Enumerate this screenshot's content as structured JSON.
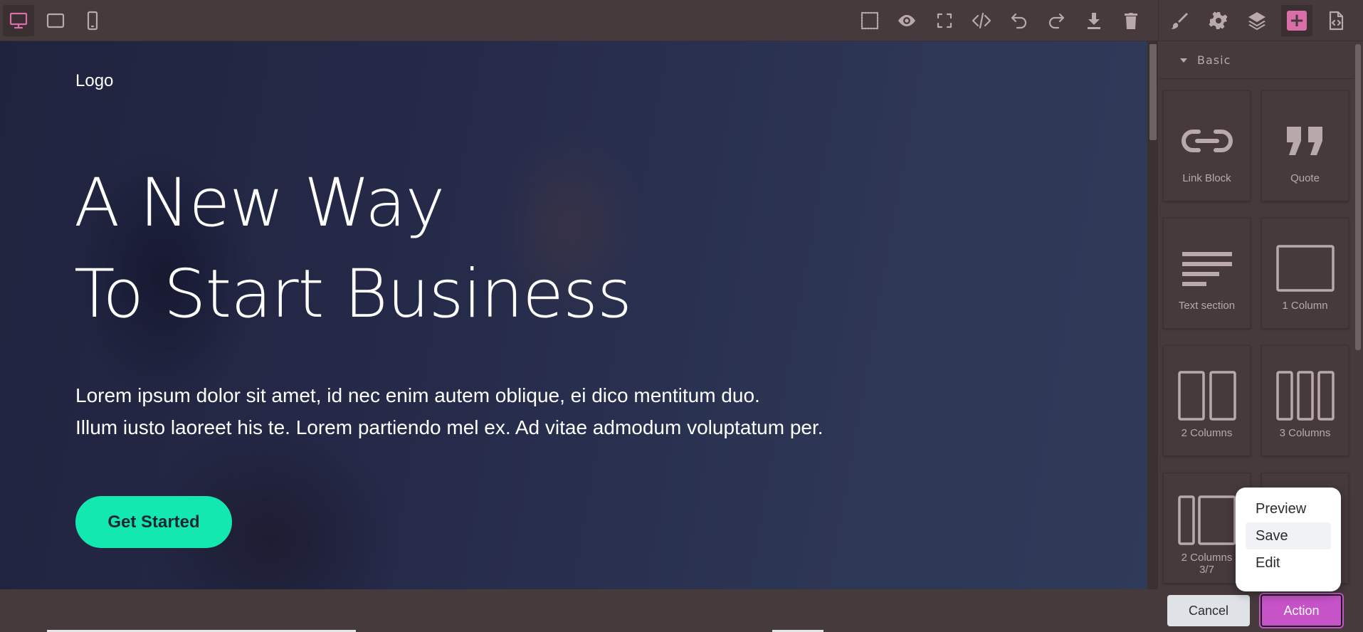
{
  "toolbar": {
    "devices": [
      {
        "name": "desktop",
        "icon": "desktop-icon",
        "active": true
      },
      {
        "name": "tablet",
        "icon": "tablet-icon",
        "active": false
      },
      {
        "name": "mobile",
        "icon": "mobile-icon",
        "active": false
      }
    ],
    "actions": [
      "sw-visibility-icon",
      "preview-eye-icon",
      "fullscreen-icon",
      "code-icon",
      "undo-icon",
      "redo-icon",
      "download-icon",
      "trash-icon"
    ],
    "panels": [
      "style-manager-brush-icon",
      "settings-gear-icon",
      "layers-icon",
      "blocks-plus-icon",
      "import-code-icon"
    ],
    "accent_color": "#d96ea8"
  },
  "canvas": {
    "logo": "Logo",
    "headline_line1": "A New Way",
    "headline_line2": "To Start Business",
    "lead_line1": "Lorem ipsum dolor sit amet, id nec enim autem oblique, ei dico mentitum duo.",
    "lead_line2": "Illum iusto laoreet his te. Lorem partiendo mel ex. Ad vitae admodum voluptatum per.",
    "cta_label": "Get Started",
    "cta_color": "#13e8b0"
  },
  "blocks": {
    "category": "Basic",
    "items": [
      {
        "label": "Link Block",
        "icon": "link-icon"
      },
      {
        "label": "Quote",
        "icon": "quote-icon"
      },
      {
        "label": "Text section",
        "icon": "text-section-icon"
      },
      {
        "label": "1 Column",
        "icon": "one-column-icon"
      },
      {
        "label": "2 Columns",
        "icon": "two-columns-icon"
      },
      {
        "label": "3 Columns",
        "icon": "three-columns-icon"
      },
      {
        "label": "2 Columns\n3/7",
        "icon": "two-columns-37-icon"
      }
    ]
  },
  "dropdown": {
    "items": [
      "Preview",
      "Save",
      "Edit"
    ],
    "hovered": "Save"
  },
  "footer": {
    "cancel_label": "Cancel",
    "action_label": "Action",
    "action_color": "#c653c8"
  }
}
